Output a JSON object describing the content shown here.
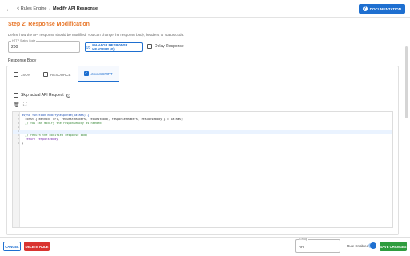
{
  "header": {
    "back_icon": "arrow-left-icon",
    "breadcrumb_root": "< Rules Engine",
    "breadcrumb_sep": "/",
    "breadcrumb_current": "Modify API Response",
    "docs_label": "DOCUMENTATION",
    "docs_icon": "help-circle-icon"
  },
  "step": {
    "title": "Step 2: Response Modification",
    "description": "Define how the API response should be modified. You can change the response body, headers, or status code."
  },
  "status_code": {
    "label": "HTTP Status Code",
    "value": "200"
  },
  "manage_headers_label": "MANAGE RESPONSE HEADERS (0)",
  "delay_label": "Delay Response",
  "response_body": {
    "title": "Response Body",
    "tabs": [
      {
        "label": "JSON",
        "active": false
      },
      {
        "label": "RESOURCE",
        "active": false
      },
      {
        "label": "JAVASCRIPT",
        "active": true
      }
    ],
    "skip_label": "Skip actual API Request",
    "editor_lines": [
      "async function modifyResponse(params) {",
      "  const { method, url, requestHeaders, requestBody, responseHeaders, responseBody } = params;",
      "  // You can modify the responseBody as needed",
      "",
      "",
      "  // return the modified response body",
      "  return responseBody",
      "}"
    ]
  },
  "footer": {
    "cancel_label": "CANCEL",
    "delete_label": "DELETE RULE",
    "group_label": "Group",
    "group_value": "API",
    "rule_enabled_label": "Rule Enabled",
    "rule_enabled": true,
    "save_label": "SAVE CHANGES"
  },
  "colors": {
    "accent": "#1e6fd0",
    "step_title": "#e8772a",
    "delete": "#d9332f",
    "save": "#2e9c3e"
  }
}
